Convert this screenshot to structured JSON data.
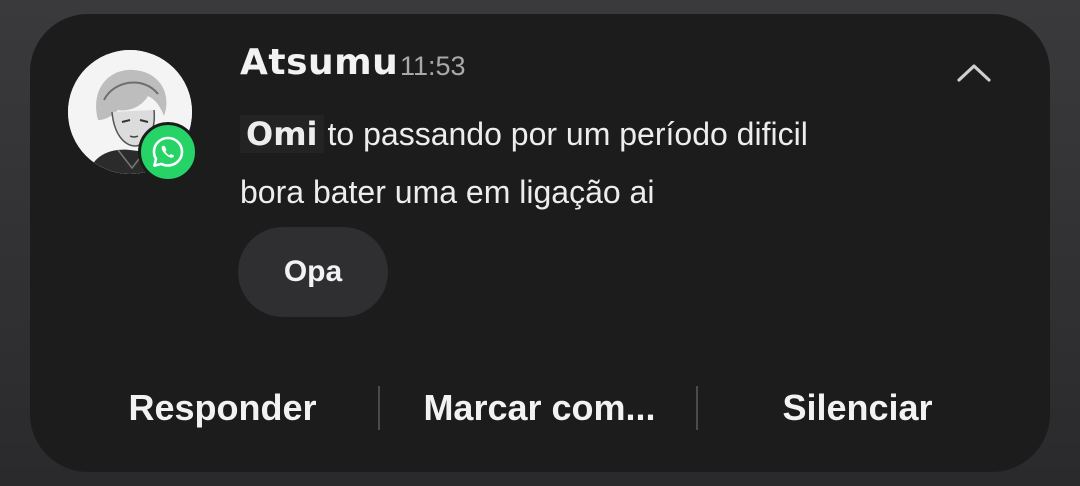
{
  "notification": {
    "sender": "Atsumu",
    "time": "11:53",
    "app_icon": "whatsapp-icon",
    "message": {
      "mention": "Omi",
      "line1_rest": "to passando por um período dificil",
      "line2": "bora bater uma em ligação ai"
    },
    "quick_reply": "Opa",
    "actions": {
      "reply": "Responder",
      "mark_as": "Marcar com...",
      "mute": "Silenciar"
    },
    "colors": {
      "card": "#1c1c1d",
      "badge": "#25d366",
      "chip": "#2f2f31"
    }
  }
}
